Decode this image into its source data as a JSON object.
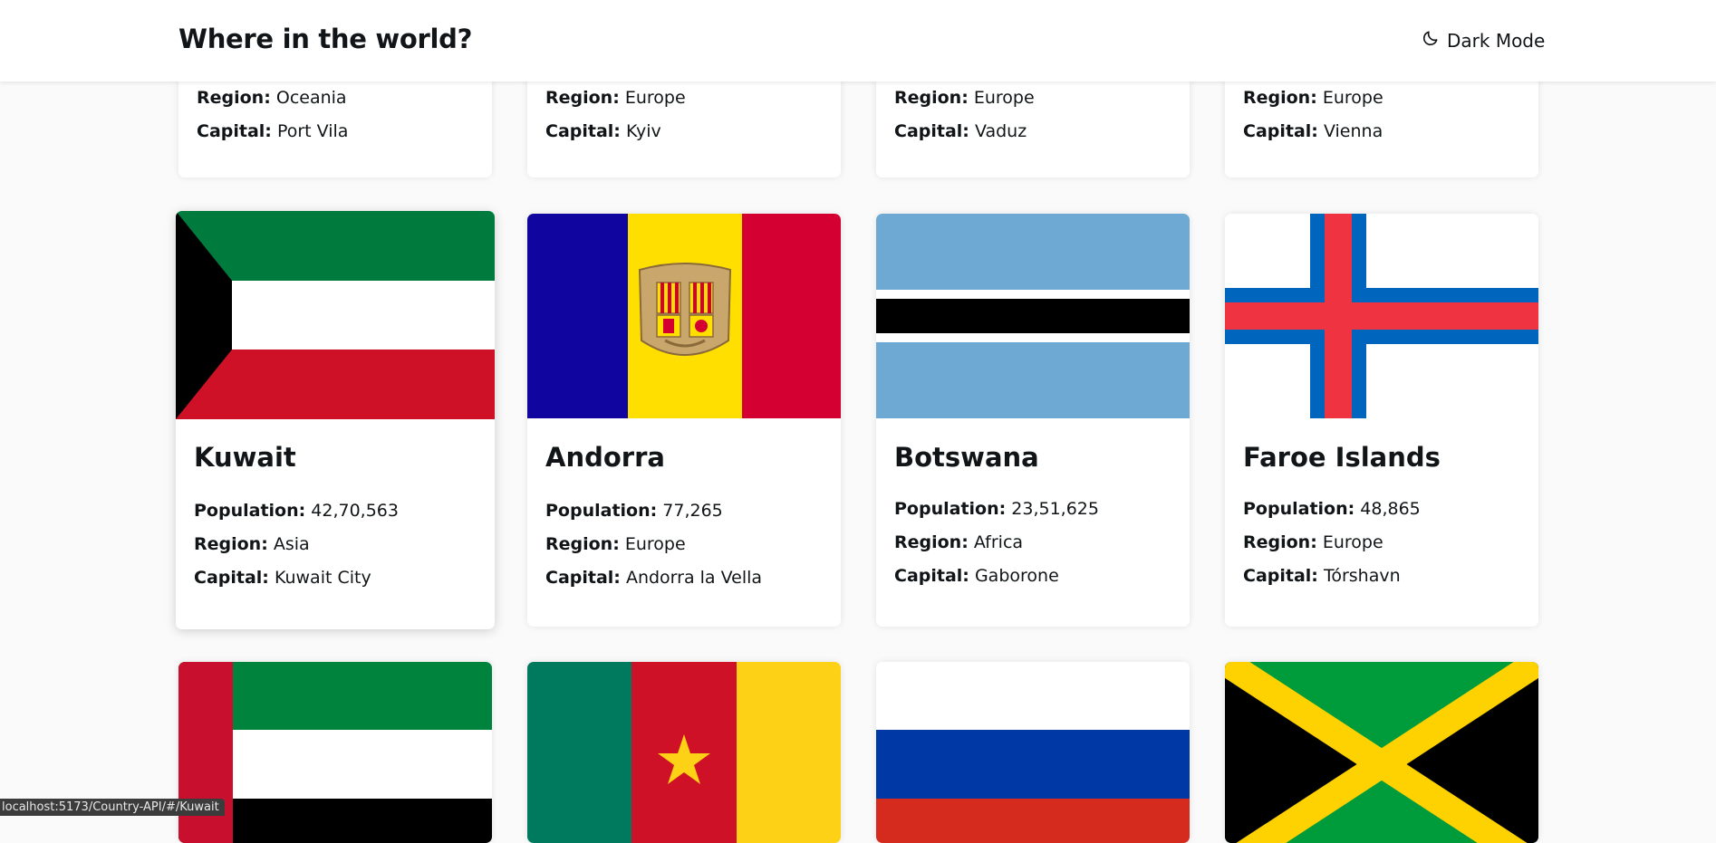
{
  "header": {
    "title": "Where in the world?",
    "dark_mode_label": "Dark Mode",
    "dark_mode_icon": "moon-icon"
  },
  "labels": {
    "population": "Population:",
    "region": "Region:",
    "capital": "Capital:"
  },
  "row1": [
    {
      "region": "Oceania",
      "capital": "Port Vila"
    },
    {
      "region": "Europe",
      "capital": "Kyiv"
    },
    {
      "region": "Europe",
      "capital": "Vaduz"
    },
    {
      "region": "Europe",
      "capital": "Vienna"
    }
  ],
  "row2": [
    {
      "name": "Kuwait",
      "population": "42,70,563",
      "region": "Asia",
      "capital": "Kuwait City",
      "flag": "kuwait-flag"
    },
    {
      "name": "Andorra",
      "population": "77,265",
      "region": "Europe",
      "capital": "Andorra la Vella",
      "flag": "andorra-flag"
    },
    {
      "name": "Botswana",
      "population": "23,51,625",
      "region": "Africa",
      "capital": "Gaborone",
      "flag": "botswana-flag"
    },
    {
      "name": "Faroe Islands",
      "population": "48,865",
      "region": "Europe",
      "capital": "Tórshavn",
      "flag": "faroe-islands-flag"
    }
  ],
  "row3_flags": [
    "uae-flag",
    "cameroon-flag",
    "russia-flag",
    "jamaica-flag"
  ],
  "status_bar": {
    "url": "localhost:5173/Country-API/#/Kuwait"
  },
  "colors": {
    "background": "#fafafa",
    "card": "#ffffff",
    "text": "#111517"
  }
}
